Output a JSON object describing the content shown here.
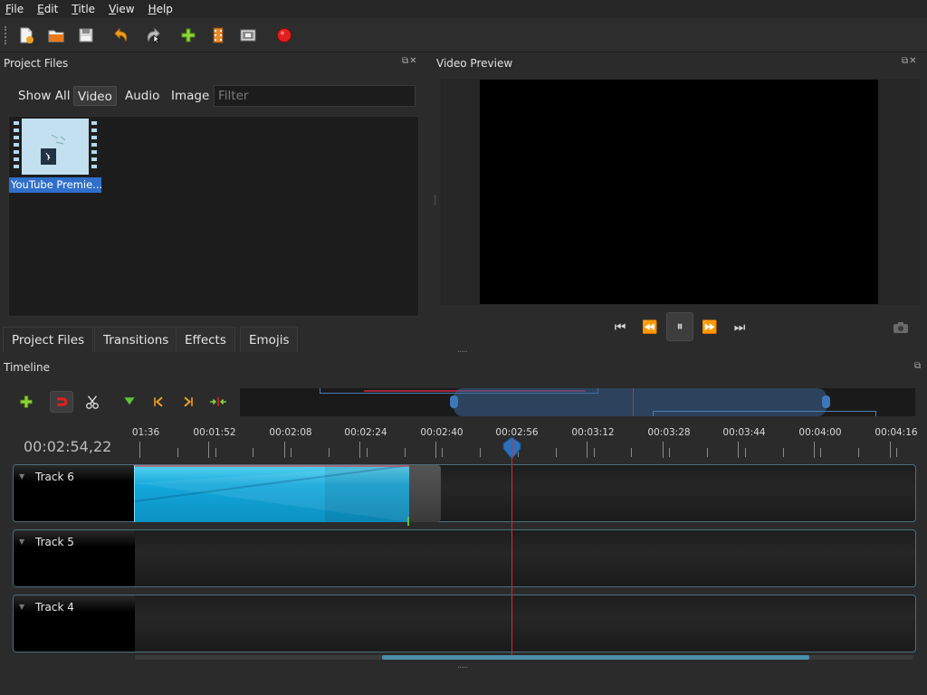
{
  "menu": [
    "File",
    "Edit",
    "Title",
    "View",
    "Help"
  ],
  "menu_mnemonics": [
    "F",
    "E",
    "T",
    "V",
    "H"
  ],
  "project_files": {
    "title": "Project Files",
    "filters": [
      "Show All",
      "Video",
      "Audio",
      "Image"
    ],
    "active_filter": "Video",
    "filter_placeholder": "Filter",
    "file_label": "YouTube Premie..."
  },
  "bottom_tabs": [
    "Project Files",
    "Transitions",
    "Effects",
    "Emojis"
  ],
  "video_preview": {
    "title": "Video Preview"
  },
  "timeline": {
    "title": "Timeline",
    "current_time": "00:02:54,22",
    "ticks": [
      "01:36",
      "00:01:52",
      "00:02:08",
      "00:02:24",
      "00:02:40",
      "00:02:56",
      "00:03:12",
      "00:03:28",
      "00:03:44",
      "00:04:00",
      "00:04:16"
    ],
    "tracks": [
      "Track 6",
      "Track 5",
      "Track 4"
    ]
  },
  "colors": {
    "accent": "#2f6fc9",
    "clip": "#14a8db",
    "playhead": "#d02c3a",
    "record": "#e02020"
  }
}
